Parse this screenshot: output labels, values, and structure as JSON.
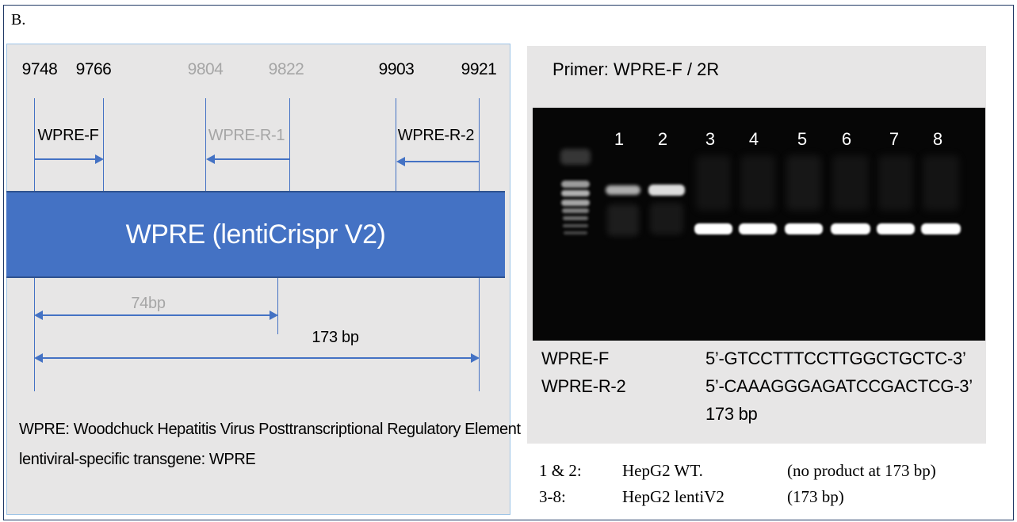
{
  "figure_label": "B.",
  "left": {
    "positions": {
      "p9748": "9748",
      "p9766": "9766",
      "p9804": "9804",
      "p9822": "9822",
      "p9903": "9903",
      "p9921": "9921"
    },
    "primers": {
      "f": "WPRE-F",
      "r1": "WPRE-R-1",
      "r2": "WPRE-R-2"
    },
    "bar_label": "WPRE (lentiCrispr V2)",
    "product_74": "74bp",
    "product_173": "173 bp",
    "notes": [
      "WPRE: Woodchuck Hepatitis Virus Posttranscriptional Regulatory Element",
      "lentiviral-specific transgene: WPRE"
    ],
    "colors": {
      "bar": "#4472c4",
      "panel": "#e7e6e6",
      "muted_text": "#a6a6a6"
    }
  },
  "right": {
    "title": "Primer: WPRE-F / 2R",
    "lanes": [
      "1",
      "2",
      "3",
      "4",
      "5",
      "6",
      "7",
      "8"
    ],
    "primer_table": {
      "names": [
        "WPRE-F",
        "WPRE-R-2"
      ],
      "sequences": [
        "5’-GTCCTTTCCTTGGCTGCTC-3’",
        "5’-CAAAGGGAGATCCGACTCG-3’"
      ],
      "size": "173 bp"
    },
    "legend": [
      {
        "lanes": "1 & 2:",
        "sample": "HepG2 WT.",
        "result": "(no product at 173 bp)"
      },
      {
        "lanes": "3-8:",
        "sample": "HepG2 lentiV2",
        "result": "(173 bp)"
      }
    ],
    "colors": {
      "gel_bg": "#060606",
      "band": "#ffffff"
    }
  }
}
